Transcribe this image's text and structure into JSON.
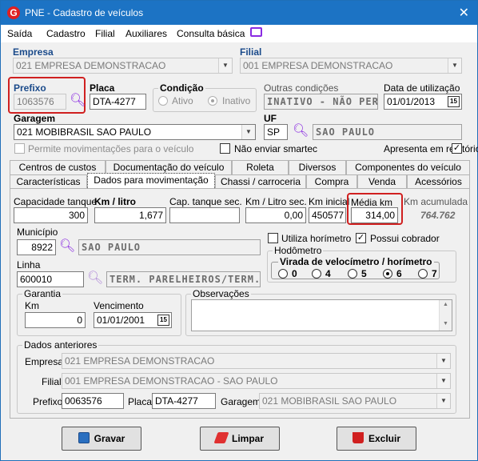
{
  "window": {
    "title": "PNE - Cadastro de veículos",
    "logo": "G",
    "close": "✕"
  },
  "menu": [
    "Saída",
    "Cadastro",
    "Filial",
    "Auxiliares",
    "Consulta básica"
  ],
  "empresa": {
    "label": "Empresa",
    "value": "021 EMPRESA DEMONSTRACAO"
  },
  "filial": {
    "label": "Filial",
    "value": "001 EMPRESA DEMONSTRACAO"
  },
  "prefixo": {
    "label": "Prefixo",
    "value": "1063576"
  },
  "placa": {
    "label": "Placa",
    "value": "DTA-4277"
  },
  "condicao": {
    "label": "Condição",
    "ativo": "Ativo",
    "inativo": "Inativo",
    "selected": "Inativo"
  },
  "outras": {
    "label": "Outras condições",
    "value": "INATIVO - NÃO PERMIT"
  },
  "data_util": {
    "label": "Data de utilização",
    "value": "01/01/2013"
  },
  "garagem": {
    "label": "Garagem",
    "value": "021 MOBIBRASIL SAO PAULO"
  },
  "uf": {
    "label": "UF",
    "code": "SP",
    "name": "SAO PAULO"
  },
  "checks": {
    "permite": "Permite movimentações para o veículo",
    "nao_enviar": "Não enviar smartec",
    "apresenta": "Apresenta em relatórios"
  },
  "tabs_row1": [
    "Centros de custos",
    "Documentação do veículo",
    "Roleta",
    "Diversos",
    "Componentes do veículo"
  ],
  "tabs_row2": [
    "Características",
    "Dados para movimentação",
    "Chassi / carroceria",
    "Compra",
    "Venda",
    "Acessórios"
  ],
  "active_tab": "Dados para movimentação",
  "mov": {
    "cap_tanque_label": "Capacidade tanque",
    "cap_tanque": "300",
    "km_litro_label": "Km / litro",
    "km_litro": "1,677",
    "cap_sec_label": "Cap. tanque sec.",
    "cap_sec": "",
    "km_litro_sec_label": "Km / Litro sec.",
    "km_litro_sec": "0,00",
    "km_inicial_label": "Km inicial",
    "km_inicial": "450577",
    "media_km_label": "Média km",
    "media_km": "314,00",
    "km_acum_label": "Km acumulada",
    "km_acum": "764.762",
    "municipio_label": "Município",
    "municipio_code": "8922",
    "municipio_name": "SAO PAULO",
    "utiliza_horimetro": "Utiliza horímetro",
    "possui_cobrador": "Possui cobrador",
    "linha_label": "Linha",
    "linha_code": "600010",
    "linha_name": "TERM. PARELHEIROS/TERM.ST",
    "hodometro_label": "Hodômetro",
    "virada_label": "Virada de velocímetro / horímetro",
    "virada_options": [
      "0",
      "4",
      "5",
      "6",
      "7"
    ],
    "virada_selected": "6",
    "garantia_label": "Garantia",
    "km_label": "Km",
    "garantia_km": "0",
    "vencimento_label": "Vencimento",
    "vencimento": "01/01/2001",
    "obs_label": "Observações"
  },
  "anteriores": {
    "label": "Dados anteriores",
    "empresa_label": "Empresa",
    "empresa": "021 EMPRESA DEMONSTRACAO",
    "filial_label": "Filial",
    "filial": "001 EMPRESA DEMONSTRACAO - SAO PAULO",
    "prefixo_label": "Prefixo",
    "prefixo": "0063576",
    "placa_label": "Placa",
    "placa": "DTA-4277",
    "garagem_label": "Garagem",
    "garagem": "021 MOBIBRASIL SAO PAULO"
  },
  "buttons": {
    "gravar": "Gravar",
    "limpar": "Limpar",
    "excluir": "Excluir"
  },
  "colors": {
    "titlebar": "#1c73c4",
    "highlight": "#d02020",
    "icon": "#8a2be2"
  }
}
